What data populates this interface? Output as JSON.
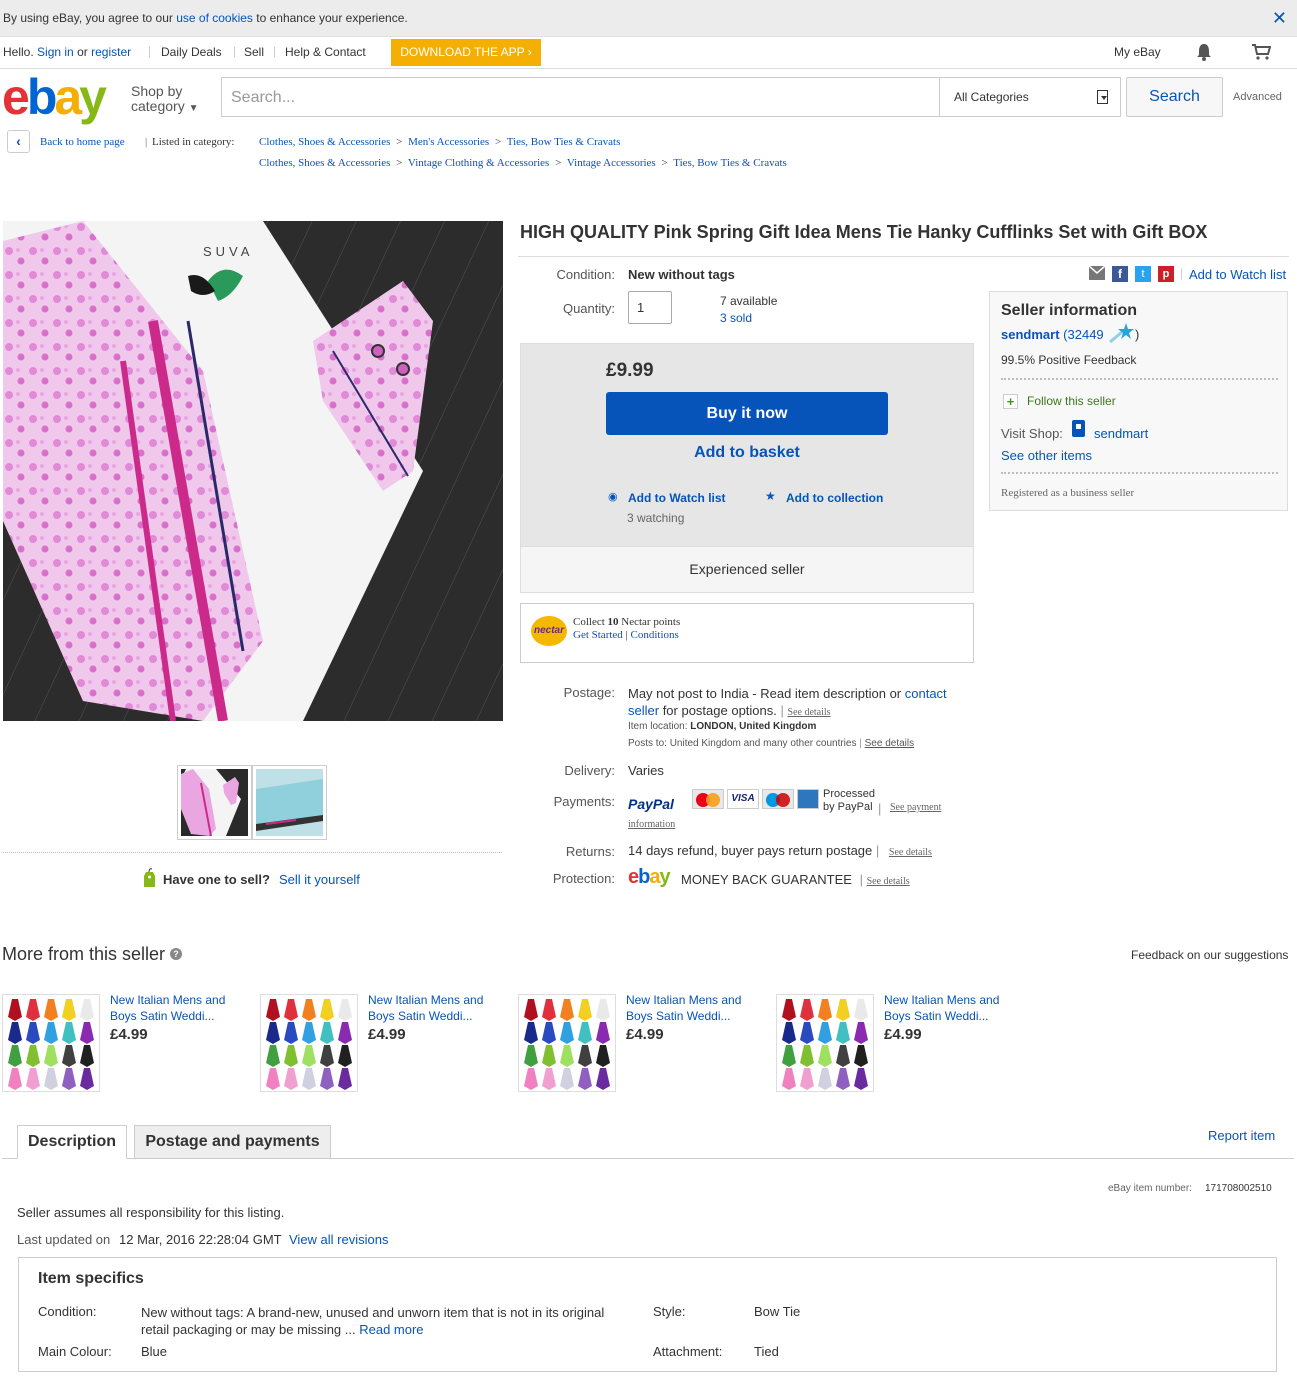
{
  "cookie": {
    "text_a": "By using eBay, you agree to our ",
    "link": "use of cookies",
    "text_b": " to enhance your experience."
  },
  "topnav": {
    "hello": "Hello.",
    "sign_in": "Sign in",
    "or": "or",
    "register": "register",
    "daily_deals": "Daily Deals",
    "sell": "Sell",
    "help": "Help & Contact",
    "download_app": "DOWNLOAD THE APP ›",
    "my_ebay": "My eBay"
  },
  "header": {
    "logo_letters": [
      "e",
      "b",
      "a",
      "y"
    ],
    "logo_colors": [
      "#e53238",
      "#0064d2",
      "#f5af02",
      "#86b817"
    ],
    "shop_by_1": "Shop by",
    "shop_by_2": "category",
    "search_placeholder": "Search...",
    "category": "All Categories",
    "search_button": "Search",
    "advanced": "Advanced"
  },
  "breadcrumb": {
    "back": "Back to home page",
    "listed_in": "Listed in category:",
    "path1": [
      "Clothes, Shoes & Accessories",
      "Men's Accessories",
      "Ties, Bow Ties & Cravats"
    ],
    "path2": [
      "Clothes, Shoes & Accessories",
      "Vintage Clothing & Accessories",
      "Vintage Accessories",
      "Ties, Bow Ties & Cravats"
    ],
    "sep": ">"
  },
  "image": {
    "brand": "SUVA"
  },
  "item": {
    "title": "HIGH QUALITY Pink Spring Gift Idea Mens Tie Hanky Cufflinks Set with Gift BOX",
    "condition_label": "Condition:",
    "condition": "New without tags",
    "quantity_label": "Quantity:",
    "quantity": "1",
    "available": "7 available",
    "sold": "3 sold",
    "add_watch_top": "Add to Watch list",
    "price": "£9.99",
    "buy_now": "Buy it now",
    "add_basket": "Add to basket",
    "add_watch": "Add to Watch list",
    "add_collection": "Add to collection",
    "watching": "3 watching",
    "experienced": "Experienced seller"
  },
  "nectar": {
    "logo": "nectar",
    "collect_a": "Collect ",
    "points": "10",
    "collect_b": " Nectar points",
    "get_started": "Get Started",
    "pipe": "|",
    "conditions": "Conditions"
  },
  "postage": {
    "label": "Postage:",
    "text_a": "May not post to India - Read item description or ",
    "contact": "contact seller",
    "text_b": " for postage options.",
    "see_details": "See details",
    "location_label": "Item location:",
    "location": "LONDON, United Kingdom",
    "posts_to_label": "Posts to:",
    "posts_to": "United Kingdom and many other countries",
    "delivery_label": "Delivery:",
    "delivery": "Varies",
    "payments_label": "Payments:",
    "paypal": "PayPal",
    "visa": "VISA",
    "mastercard": "MasterCard",
    "maestro": "Maestro",
    "amex": "AMEX",
    "processed_1": "Processed",
    "processed_2": "by PayPal",
    "see_payment_1": "See payment",
    "see_payment_2": "information",
    "returns_label": "Returns:",
    "returns": "14 days refund, buyer pays return postage",
    "protection_label": "Protection:",
    "money_back": "MONEY BACK GUARANTEE"
  },
  "seller": {
    "heading": "Seller information",
    "name": "sendmart",
    "score": "32449",
    "feedback": "99.5% Positive Feedback",
    "follow": "Follow this seller",
    "visit_shop": "Visit Shop:",
    "shop_name": "sendmart",
    "see_other": "See other items",
    "registered": "Registered as a business seller"
  },
  "sell_prompt": {
    "question": "Have one to sell?",
    "link": "Sell it yourself"
  },
  "more": {
    "heading": "More from this seller",
    "feedback": "Feedback on our suggestions",
    "cards": [
      {
        "title": "New Italian Mens and Boys Satin Weddi...",
        "price": "£4.99"
      },
      {
        "title": "New Italian Mens and Boys Satin Weddi...",
        "price": "£4.99"
      },
      {
        "title": "New Italian Mens and Boys Satin Weddi...",
        "price": "£4.99"
      },
      {
        "title": "New Italian Mens and Boys Satin Weddi...",
        "price": "£4.99"
      }
    ]
  },
  "tabs": {
    "description": "Description",
    "postage": "Postage and payments",
    "report": "Report item"
  },
  "description": {
    "item_number_label": "eBay item number:",
    "item_number": "171708002510",
    "responsibility": "Seller assumes all responsibility for this listing.",
    "last_updated_label": "Last updated on",
    "last_updated": "12 Mar, 2016 22:28:04 GMT",
    "view_revisions": "View all revisions"
  },
  "specifics": {
    "heading": "Item specifics",
    "condition_label": "Condition:",
    "condition_1": "New without tags: A brand-new, unused and unworn item that is not in its original",
    "condition_2": "retail packaging or may be missing ... ",
    "read_more": "Read more",
    "colour_label": "Main Colour:",
    "colour": "Blue",
    "style_label": "Style:",
    "style": "Bow Tie",
    "attachment_label": "Attachment:",
    "attachment": "Tied"
  }
}
